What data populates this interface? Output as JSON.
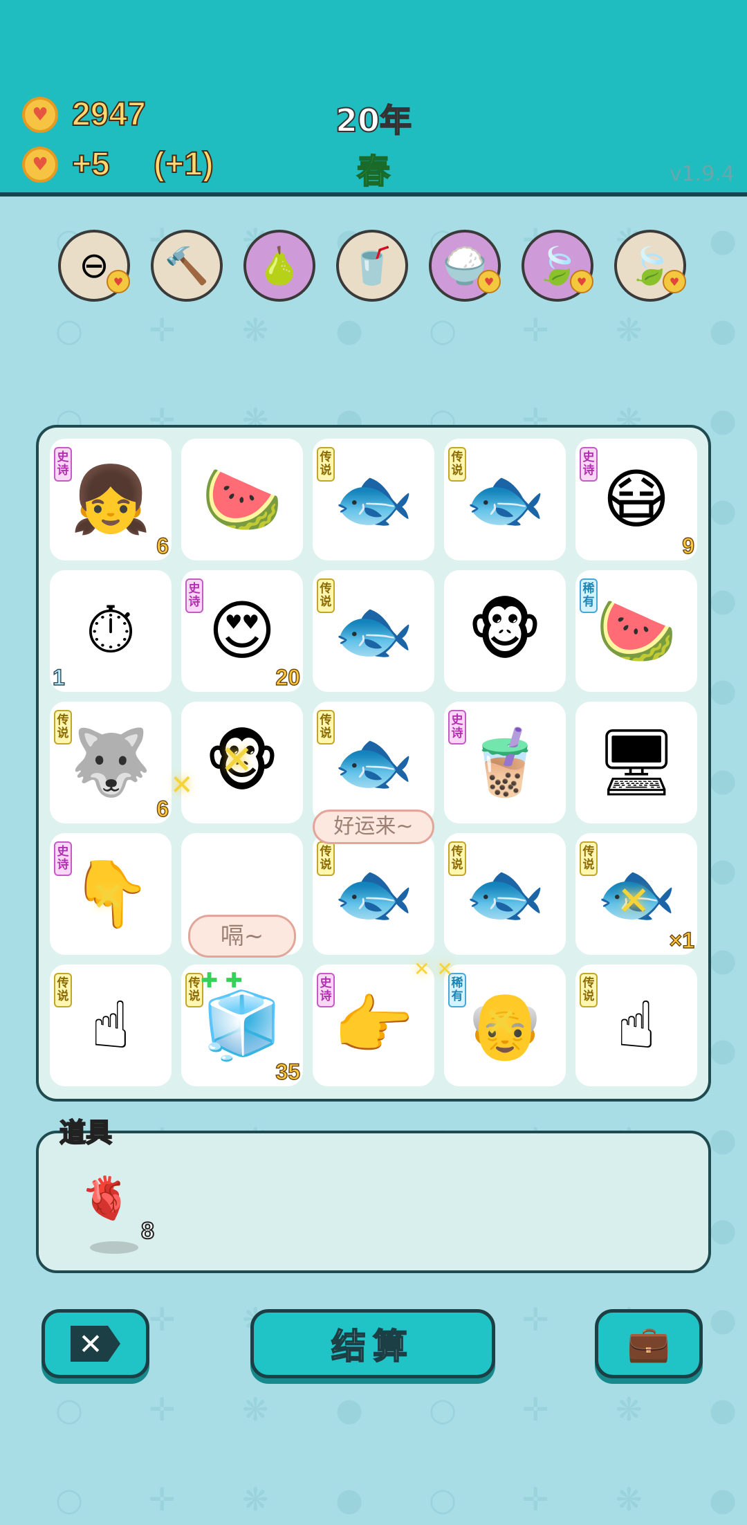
{
  "header": {
    "coins": "2947",
    "income": "+5",
    "bonus": "(+1)",
    "year": "20年",
    "season": "春",
    "version": "v1.9.4"
  },
  "top_items": [
    {
      "icon": "minus-circle-icon",
      "glyph": "⊖",
      "badge": true,
      "bg": "#e9ddc7"
    },
    {
      "icon": "hammer-icon",
      "glyph": "🔨",
      "badge": false,
      "bg": "#e9ddc7"
    },
    {
      "icon": "pomelo-icon",
      "glyph": "🍐",
      "badge": false,
      "bg": "#cf9ad8"
    },
    {
      "icon": "cup-icon",
      "glyph": "🥤",
      "badge": false,
      "bg": "#e9ddc7"
    },
    {
      "icon": "rice-bowl-icon",
      "glyph": "🍚",
      "badge": true,
      "bg": "#cf9ad8"
    },
    {
      "icon": "leaf-icon",
      "glyph": "🍃",
      "badge": true,
      "bg": "#cf9ad8"
    },
    {
      "icon": "leaf-icon",
      "glyph": "🍃",
      "badge": true,
      "bg": "#e9ddc7"
    }
  ],
  "board": {
    "cells": [
      {
        "tag": "史诗",
        "tagType": "epic",
        "glyph": "👧",
        "num": "6",
        "numPos": "br"
      },
      {
        "tag": "",
        "tagType": "",
        "glyph": "🍉",
        "num": "",
        "numPos": ""
      },
      {
        "tag": "传说",
        "tagType": "legend",
        "glyph": "🐟",
        "num": "",
        "numPos": ""
      },
      {
        "tag": "传说",
        "tagType": "legend",
        "glyph": "🐟",
        "num": "",
        "numPos": ""
      },
      {
        "tag": "史诗",
        "tagType": "epic",
        "glyph": "😷",
        "num": "9",
        "numPos": "br"
      },
      {
        "tag": "",
        "tagType": "",
        "glyph": "⏱",
        "num": "1",
        "numPos": "bl"
      },
      {
        "tag": "史诗",
        "tagType": "epic",
        "glyph": "😍",
        "num": "20",
        "numPos": "br"
      },
      {
        "tag": "传说",
        "tagType": "legend",
        "glyph": "🐟",
        "num": "",
        "numPos": ""
      },
      {
        "tag": "",
        "tagType": "",
        "glyph": "🐵",
        "num": "",
        "numPos": ""
      },
      {
        "tag": "稀有",
        "tagType": "rare",
        "glyph": "🍉",
        "num": "",
        "numPos": ""
      },
      {
        "tag": "传说",
        "tagType": "legend",
        "glyph": "🐺",
        "num": "6",
        "numPos": "br"
      },
      {
        "tag": "",
        "tagType": "",
        "glyph": "🐵",
        "num": "",
        "numPos": ""
      },
      {
        "tag": "传说",
        "tagType": "legend",
        "glyph": "🐟",
        "num": "",
        "numPos": ""
      },
      {
        "tag": "史诗",
        "tagType": "epic",
        "glyph": "🧋",
        "num": "",
        "numPos": ""
      },
      {
        "tag": "",
        "tagType": "",
        "glyph": "🖥",
        "num": "",
        "numPos": ""
      },
      {
        "tag": "史诗",
        "tagType": "epic",
        "glyph": "👇",
        "num": "",
        "numPos": ""
      },
      {
        "tag": "",
        "tagType": "",
        "glyph": "",
        "num": "",
        "numPos": ""
      },
      {
        "tag": "传说",
        "tagType": "legend",
        "glyph": "🐟",
        "num": "",
        "numPos": ""
      },
      {
        "tag": "传说",
        "tagType": "legend",
        "glyph": "🐟",
        "num": "",
        "numPos": ""
      },
      {
        "tag": "传说",
        "tagType": "legend",
        "glyph": "🐟",
        "num": "×1",
        "numPos": "br"
      },
      {
        "tag": "传说",
        "tagType": "legend",
        "glyph": "☝",
        "num": "",
        "numPos": ""
      },
      {
        "tag": "传说",
        "tagType": "legend",
        "glyph": "🧊",
        "num": "35",
        "numPos": "br"
      },
      {
        "tag": "史诗",
        "tagType": "epic",
        "glyph": "👉",
        "num": "",
        "numPos": ""
      },
      {
        "tag": "稀有",
        "tagType": "rare",
        "glyph": "👴",
        "num": "",
        "numPos": ""
      },
      {
        "tag": "传说",
        "tagType": "legend",
        "glyph": "☝",
        "num": "",
        "numPos": ""
      }
    ],
    "bubble_lucky": "好运来~",
    "bubble_hiccup": "嗝~"
  },
  "items_panel": {
    "title": "道具",
    "liver_count": "8"
  },
  "buttons": {
    "settle": "结算"
  },
  "colors": {
    "header": "#1fbcc0",
    "background": "#a8dde5",
    "button": "#20c3c6",
    "outline": "#1b3f44"
  }
}
